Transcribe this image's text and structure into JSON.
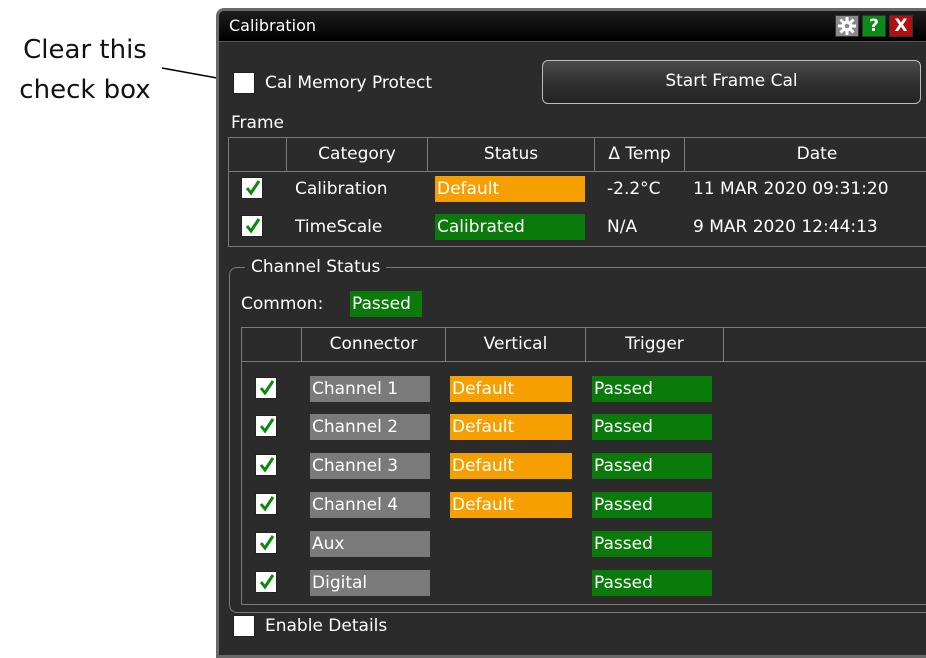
{
  "callout": {
    "line1": "Clear this",
    "line2": "check box"
  },
  "window": {
    "title": "Calibration"
  },
  "titlebar": {
    "help_label": "?",
    "close_label": "X"
  },
  "cal_memory_protect": {
    "label": "Cal Memory Protect",
    "checked": false
  },
  "start_button": {
    "label": "Start Frame Cal"
  },
  "frame": {
    "label": "Frame",
    "columns": [
      "Category",
      "Status",
      "Δ Temp",
      "Date"
    ],
    "rows": [
      {
        "checked": true,
        "category": "Calibration",
        "status": "Default",
        "status_color": "#f5a000",
        "temp": "-2.2°C",
        "date": "11 MAR 2020 09:31:20"
      },
      {
        "checked": true,
        "category": "TimeScale",
        "status": "Calibrated",
        "status_color": "#0a7a0a",
        "temp": "N/A",
        "date": "9 MAR 2020 12:44:13"
      }
    ]
  },
  "channel_status": {
    "title": "Channel Status",
    "common_label": "Common:",
    "common_value": "Passed",
    "columns": [
      "Connector",
      "Vertical",
      "Trigger"
    ],
    "rows": [
      {
        "checked": true,
        "connector": "Channel 1",
        "vertical": "Default",
        "trigger": "Passed"
      },
      {
        "checked": true,
        "connector": "Channel 2",
        "vertical": "Default",
        "trigger": "Passed"
      },
      {
        "checked": true,
        "connector": "Channel 3",
        "vertical": "Default",
        "trigger": "Passed"
      },
      {
        "checked": true,
        "connector": "Channel 4",
        "vertical": "Default",
        "trigger": "Passed"
      },
      {
        "checked": true,
        "connector": "Aux",
        "vertical": "",
        "trigger": "Passed"
      },
      {
        "checked": true,
        "connector": "Digital",
        "vertical": "",
        "trigger": "Passed"
      }
    ]
  },
  "enable_details": {
    "label": "Enable Details",
    "checked": false
  },
  "colors": {
    "default": "#f5a000",
    "passed": "#0a7a0a",
    "connector": "#7a7a7a",
    "check": "#0a8a0a"
  }
}
